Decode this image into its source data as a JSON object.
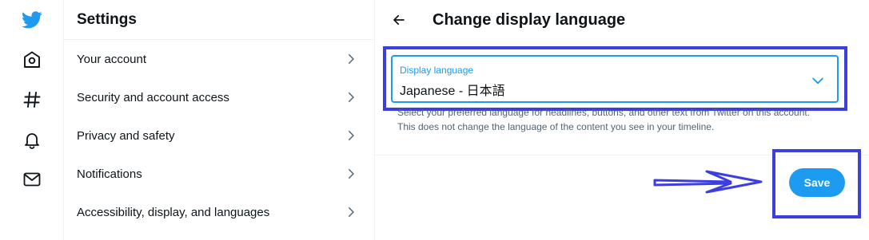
{
  "nav": {
    "icons": [
      "twitter-logo-icon",
      "home-icon",
      "hashtag-icon",
      "bell-icon",
      "mail-icon"
    ]
  },
  "settings": {
    "title": "Settings",
    "items": [
      {
        "label": "Your account"
      },
      {
        "label": "Security and account access"
      },
      {
        "label": "Privacy and safety"
      },
      {
        "label": "Notifications"
      },
      {
        "label": "Accessibility, display, and languages"
      }
    ]
  },
  "detail": {
    "title": "Change display language",
    "select": {
      "label": "Display language",
      "value": "Japanese - 日本語"
    },
    "help_text": "Select your preferred language for headlines, buttons, and other text from Twitter on this account. This does not change the language of the content you see in your timeline.",
    "save_label": "Save"
  },
  "colors": {
    "accent": "#1d9bf0",
    "annotation": "#3d3ee0",
    "text": "#0f1419",
    "muted": "#536471"
  }
}
